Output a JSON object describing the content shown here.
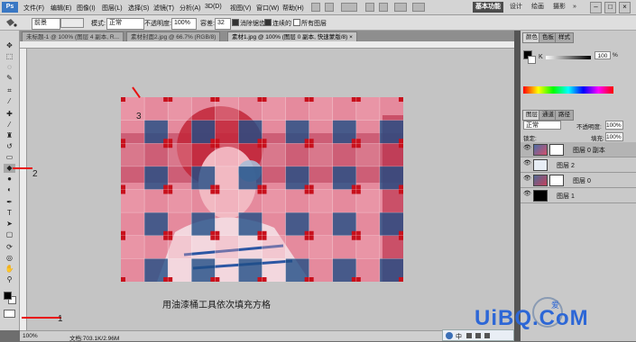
{
  "menubar": {
    "app_logo": "Ps",
    "items": [
      "文件(F)",
      "编辑(E)",
      "图像(I)",
      "图层(L)",
      "选择(S)",
      "滤镜(T)",
      "分析(A)",
      "3D(D)",
      "视图(V)",
      "窗口(W)",
      "帮助(H)"
    ],
    "workspaces": [
      "基本功能",
      "设计",
      "绘画",
      "摄影"
    ],
    "active_workspace": "基本功能",
    "overflow": "»",
    "window_controls": [
      "–",
      "□",
      "×"
    ]
  },
  "options": {
    "fill_source": "前景",
    "mode_label": "模式:",
    "mode_value": "正常",
    "opacity_label": "不透明度:",
    "opacity_value": "100%",
    "tolerance_label": "容差:",
    "tolerance_value": "32",
    "antialias_label": "消除锯齿",
    "contiguous_label": "连续的",
    "all_layers_label": "所有图层"
  },
  "doc_tabs": [
    "未标题-1 @ 100% (图层 4 副本, R...",
    "素材封面2.jpg @ 66.7% (RGB/8)",
    "素材1.jpg @ 100% (图层 0 副本, 快速蒙版/8) ×"
  ],
  "active_tab_index": 2,
  "annotations": {
    "arrow_canvas_label": "3",
    "arrow_tool_label": "2",
    "arrow_bottom_label": "1",
    "caption": "用油漆桶工具依次填充方格"
  },
  "status": {
    "zoom": "100%",
    "doc_info": "文档:703.1K/2.96M"
  },
  "colors": {
    "foreground": "#000000",
    "background": "#ffffff",
    "grid_red": "#c8101c",
    "grid_blue": "#1f4e86",
    "grid_light": "#f0a9b6",
    "accent_arrow": "#e81010"
  },
  "color_panel": {
    "tabs": [
      "颜色",
      "色板",
      "样式"
    ],
    "slider_label": "K",
    "slider_value": "100",
    "unit": "%"
  },
  "layers_panel": {
    "tabs": [
      "图层",
      "通道",
      "路径"
    ],
    "blend_mode": "正常",
    "opacity_label": "不透明度:",
    "opacity_value": "100%",
    "lock_label": "锁定:",
    "fill_label": "填充:",
    "fill_value": "100%",
    "layers": [
      {
        "name": "图层 0 副本",
        "selected": true
      },
      {
        "name": "图层 2",
        "selected": false
      },
      {
        "name": "图层 0",
        "selected": false
      },
      {
        "name": "图层 1",
        "selected": false
      }
    ]
  },
  "taskbar": {
    "ime_label": "中"
  },
  "watermark": {
    "brand_text": "UiBQ.CoM",
    "logo_char": "爱"
  }
}
